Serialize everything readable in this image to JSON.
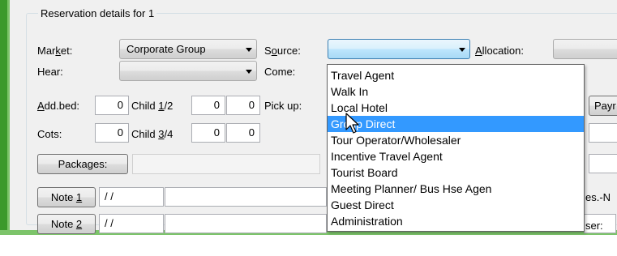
{
  "group_title": "Reservation details for 1",
  "row1": {
    "market_label": "Market:",
    "market_value": "Corporate Group",
    "source_label": "Source:",
    "source_value": "",
    "allocation_label": "Allocation:"
  },
  "row2": {
    "hear_label": "Hear:",
    "hear_value": "",
    "come_label": "Come:"
  },
  "row3": {
    "addbed_label": "Add.bed:",
    "addbed_value": "0",
    "child12_label": "Child 1/2",
    "child12_value_a": "0",
    "child12_value_b": "0",
    "pickup_label": "Pick up:",
    "pay_label": "Payr"
  },
  "row4": {
    "cots_label": "Cots:",
    "cots_value": "0",
    "child34_label": "Child 3/4",
    "child34_value_a": "0",
    "child34_value_b": "0"
  },
  "packages_label": "Packages:",
  "note1": {
    "label": "Note 1",
    "date": "/ /",
    "right_text": "es.-N"
  },
  "note2": {
    "label": "Note 2",
    "date": "/ /",
    "right_text": "ser:"
  },
  "source_dropdown": {
    "options": [
      "Travel Agent",
      "Walk In",
      "Local Hotel",
      "Group Direct",
      "Tour Operator/Wholesaler",
      "Incentive Travel Agent",
      "Tourist Board",
      "Meeting Planner/ Bus Hse Agen",
      "Guest Direct",
      "Administration"
    ],
    "selected": "Group Direct"
  },
  "colors": {
    "selection": "#3399ff",
    "window_frame": "#3b9a2b",
    "panel": "#f0f0f0"
  }
}
